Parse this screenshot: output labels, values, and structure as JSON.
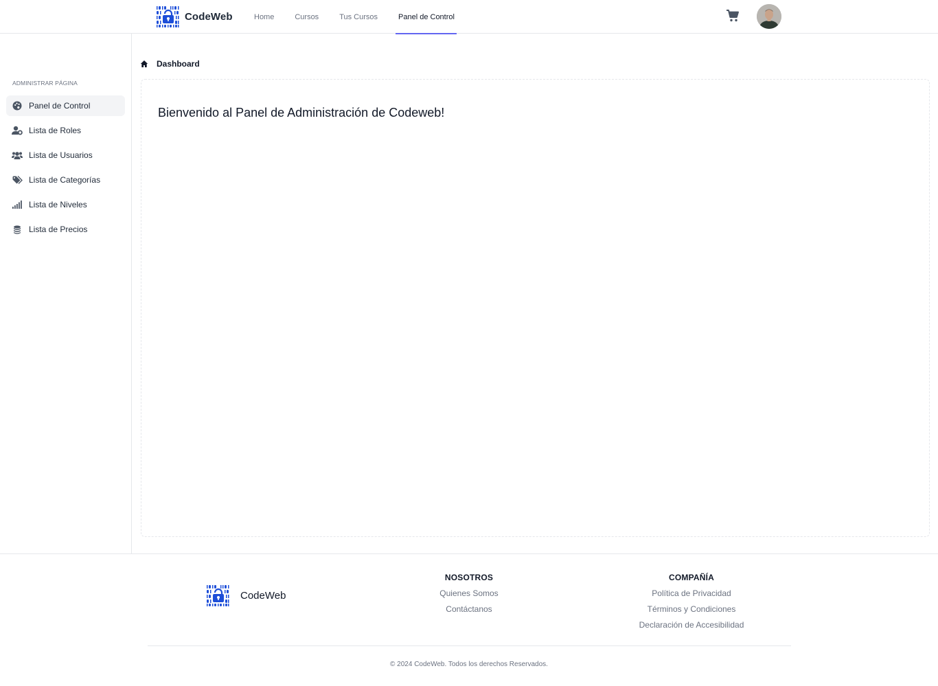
{
  "brand": {
    "name": "CodeWeb",
    "logo_icon": "binary-lock-logo",
    "color": "#1d4ed8"
  },
  "nav": {
    "links": [
      {
        "label": "Home",
        "active": false
      },
      {
        "label": "Cursos",
        "active": false
      },
      {
        "label": "Tus Cursos",
        "active": false
      },
      {
        "label": "Panel de Control",
        "active": true
      }
    ],
    "accent": "#6366f1",
    "cart_icon": "shopping-cart-icon",
    "avatar_icon": "user-avatar"
  },
  "sidebar": {
    "title": "ADMINISTRAR PÁGINA",
    "items": [
      {
        "label": "Panel de Control",
        "icon": "palette-icon",
        "active": true
      },
      {
        "label": "Lista de Roles",
        "icon": "user-gear-icon",
        "active": false
      },
      {
        "label": "Lista de Usuarios",
        "icon": "users-icon",
        "active": false
      },
      {
        "label": "Lista de Categorías",
        "icon": "tags-icon",
        "active": false
      },
      {
        "label": "Lista de Niveles",
        "icon": "signal-bars-icon",
        "active": false
      },
      {
        "label": "Lista de Precios",
        "icon": "coins-icon",
        "active": false
      }
    ]
  },
  "breadcrumb": {
    "icon": "home-icon",
    "current": "Dashboard"
  },
  "main": {
    "welcome": "Bienvenido al Panel de Administración de Codeweb!"
  },
  "footer": {
    "brand_name": "CodeWeb",
    "columns": [
      {
        "title": "NOSOTROS",
        "links": [
          "Quienes Somos",
          "Contáctanos"
        ]
      },
      {
        "title": "COMPAÑÍA",
        "links": [
          "Política de Privacidad",
          "Términos y Condiciones",
          "Declaración de Accesibilidad"
        ]
      }
    ],
    "copyright": "© 2024 CodeWeb. Todos los derechos Reservados."
  }
}
